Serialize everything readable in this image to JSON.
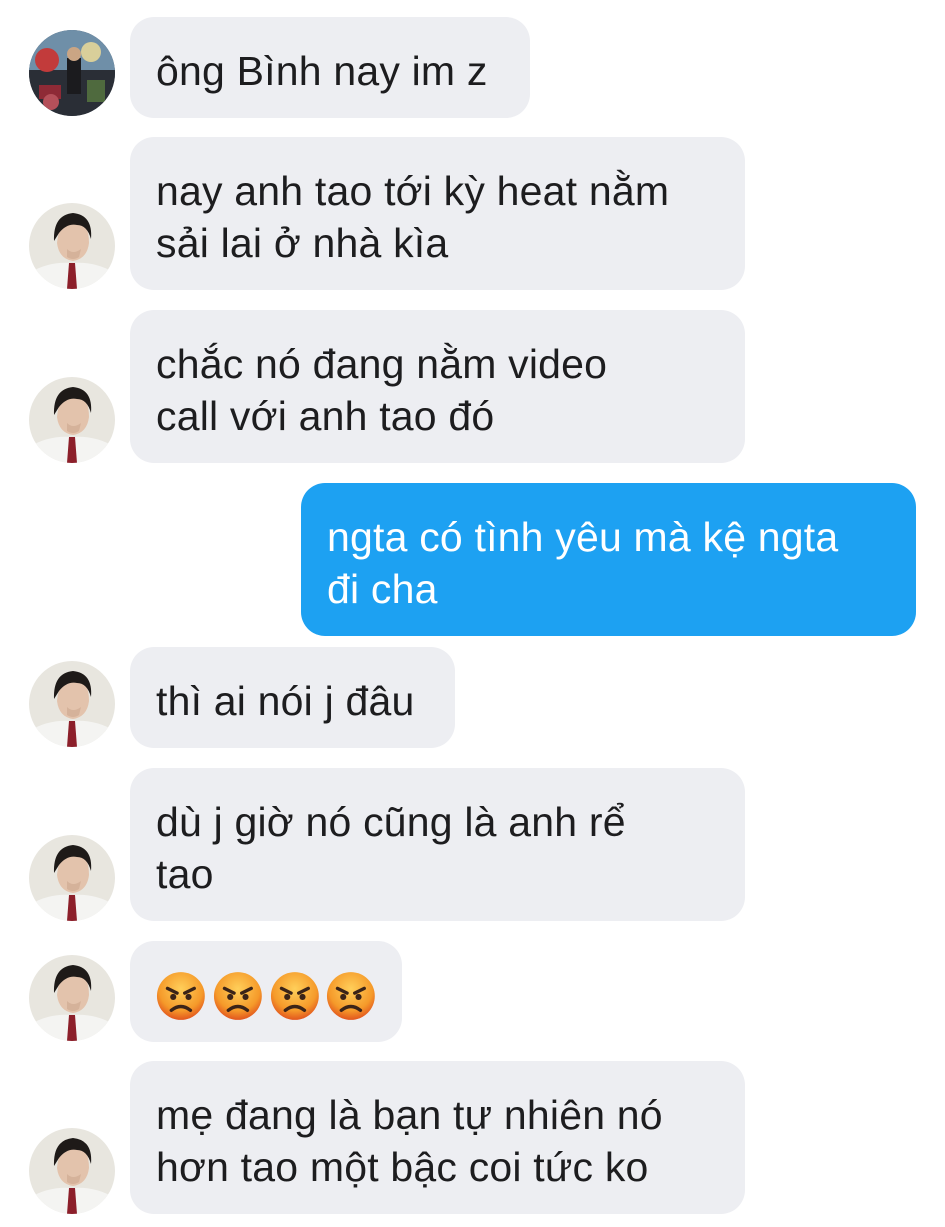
{
  "messages": [
    {
      "id": "m1",
      "direction": "incoming",
      "avatar": "avatar-graffiti",
      "lines": [
        "ông Bình nay im z"
      ]
    },
    {
      "id": "m2",
      "direction": "incoming",
      "avatar": "avatar-person",
      "lines": [
        "nay anh tao tới kỳ heat nằm",
        "sải lai ở nhà kìa"
      ]
    },
    {
      "id": "m3",
      "direction": "incoming",
      "avatar": "avatar-person",
      "lines": [
        "chắc nó đang nằm video",
        "call với anh tao đó"
      ]
    },
    {
      "id": "m4",
      "direction": "outgoing",
      "avatar": "",
      "lines": [
        "ngta có tình yêu mà kệ ngta",
        "đi cha"
      ]
    },
    {
      "id": "m5",
      "direction": "incoming",
      "avatar": "avatar-person",
      "lines": [
        "thì ai nói j đâu"
      ]
    },
    {
      "id": "m6",
      "direction": "incoming",
      "avatar": "avatar-person",
      "lines": [
        "dù j giờ nó cũng là anh rể",
        "tao"
      ]
    },
    {
      "id": "m7",
      "direction": "incoming",
      "avatar": "avatar-person",
      "emoji": [
        "pouting-face-emoji",
        "pouting-face-emoji",
        "pouting-face-emoji",
        "pouting-face-emoji"
      ]
    },
    {
      "id": "m8",
      "direction": "incoming",
      "avatar": "avatar-person",
      "lines": [
        "mẹ đang là bạn tự nhiên nó",
        "hơn tao một bậc coi tức ko"
      ]
    }
  ],
  "colors": {
    "incoming_bubble": "#edeef2",
    "outgoing_bubble": "#1da1f2",
    "incoming_text": "#1d1d1f",
    "outgoing_text": "#ffffff"
  }
}
